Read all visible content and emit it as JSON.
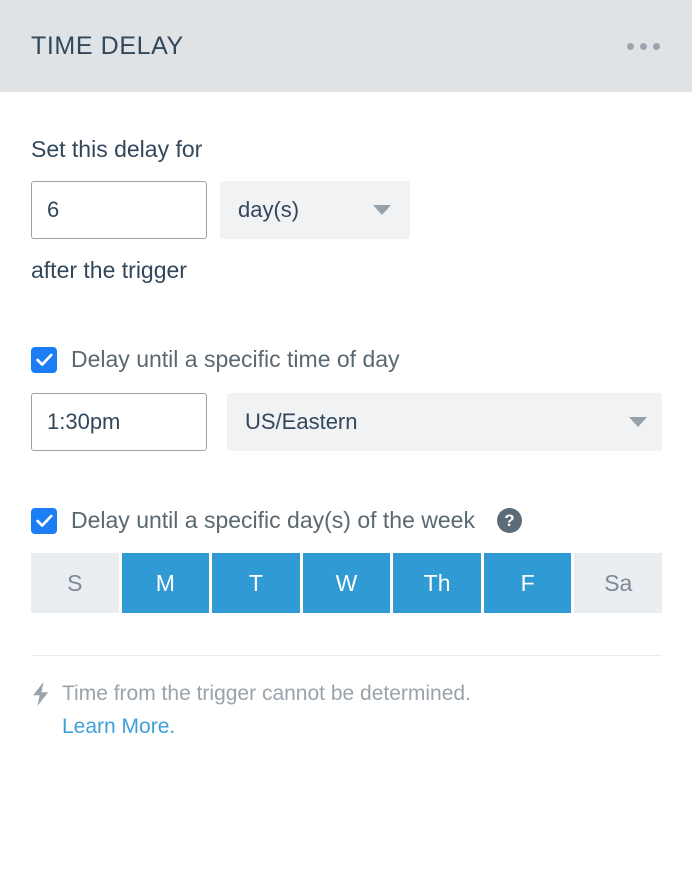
{
  "header": {
    "title": "TIME DELAY",
    "menu_icon": "kebab-menu-icon"
  },
  "delay": {
    "label": "Set this delay for",
    "amount_value": "6",
    "unit_value": "day(s)",
    "after_label": "after the trigger"
  },
  "time_of_day": {
    "checkbox_label": "Delay until a specific time of day",
    "checked": true,
    "time_value": "1:30pm",
    "timezone_value": "US/Eastern"
  },
  "day_of_week": {
    "checkbox_label": "Delay until a specific day(s) of the week",
    "checked": true,
    "help_icon": "question-mark-icon",
    "days": [
      {
        "label": "S",
        "selected": false
      },
      {
        "label": "M",
        "selected": true
      },
      {
        "label": "T",
        "selected": true
      },
      {
        "label": "W",
        "selected": true
      },
      {
        "label": "Th",
        "selected": true
      },
      {
        "label": "F",
        "selected": true
      },
      {
        "label": "Sa",
        "selected": false
      }
    ]
  },
  "note": {
    "icon": "lightning-bolt-icon",
    "text": "Time from the trigger cannot be determined.",
    "link_label": "Learn More."
  },
  "colors": {
    "header_bg": "#dfe3e6",
    "checkbox_blue": "#1b7ef5",
    "day_selected_blue": "#2f9ad3",
    "link_blue": "#3ea0db",
    "heading_text": "#33475b",
    "muted_text": "#99a3ab"
  }
}
